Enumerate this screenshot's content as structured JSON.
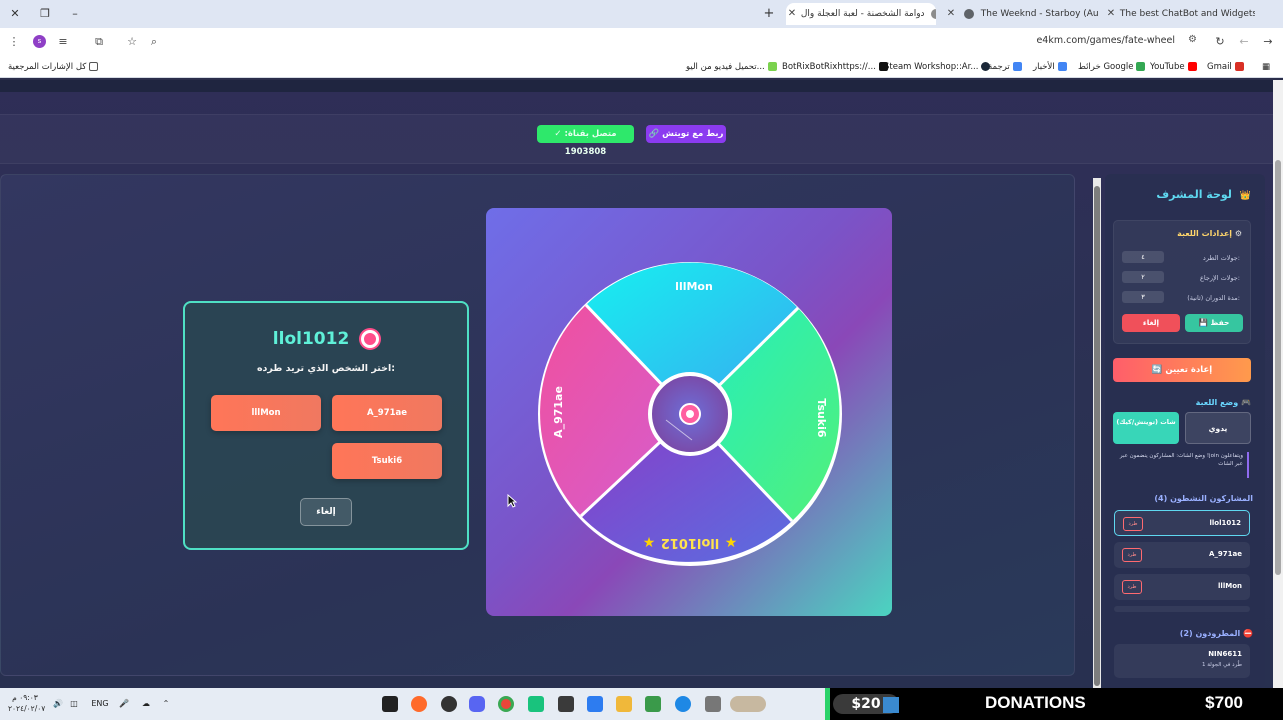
{
  "browser": {
    "tabs": [
      {
        "title": "The best ChatBot and Widgets",
        "favicon_color": "#2b2b2b"
      },
      {
        "title": "The Weeknd - Starboy (Au",
        "favicon_color": "#ff0000"
      },
      {
        "title": "دوامة الشخصنة - لعبة العجلة وال",
        "favicon_color": "#8c8c8c",
        "active": true
      }
    ],
    "new_tab_label": "+",
    "url": "e4km.com/games/fate-wheel",
    "profile_initial": "s",
    "bookmarks": [
      {
        "label": "Gmail",
        "color": "#d93025"
      },
      {
        "label": "YouTube",
        "color": "#ff0000"
      },
      {
        "label": "خرائط Google",
        "color": "#34a853"
      },
      {
        "label": "الأخبار",
        "color": "#4285f4"
      },
      {
        "label": "ترجمة",
        "color": "#4285f4"
      },
      {
        "label": "Steam Workshop::Ar...",
        "color": "#1b2838"
      },
      {
        "label": "BotRixBotRixhttps://...",
        "color": "#111111"
      },
      {
        "label": "تحميل فيديو من اليو...",
        "color": "#7bd24e"
      }
    ],
    "all_bookmarks_label": "كل الإشارات المرجعية"
  },
  "header": {
    "connected_label": "✓ متصل بقناة: 1903808",
    "twitch_button_label": "🔗 ربط مع تويتش"
  },
  "modal": {
    "title": "llol1012",
    "prompt": "اختر الشخص الذي تريد طرده:",
    "options": [
      "A_971ae",
      "lllMon",
      "Tsuki6"
    ],
    "cancel_label": "إلغاء"
  },
  "wheel": {
    "segments": [
      {
        "name": "lllMon",
        "color": "#25e3ee"
      },
      {
        "name": "Tsuki6",
        "color": "#3ef0a8"
      },
      {
        "name": "llol1012",
        "color": "#7a4ad8"
      },
      {
        "name": "A_971ae",
        "color": "#ef5cb4"
      }
    ],
    "highlighted": "llol1012"
  },
  "sidebar": {
    "title": "لوحة المشرف",
    "settings": {
      "heading": "إعدادات اللعبة",
      "rows": [
        {
          "label": "جولات الطرد:",
          "value": "٤"
        },
        {
          "label": "جولات الإرجاع:",
          "value": "٢"
        },
        {
          "label": "مدة الدوران (ثانية):",
          "value": "٣"
        }
      ],
      "save_label": "💾 حفظ",
      "cancel_label": "إلغاء"
    },
    "reset_label": "🔄 إعادة تعيين",
    "mode": {
      "heading": "وضع اللعبة",
      "chat_label": "شات (تويتش/كيك)",
      "manual_label": "يدوي",
      "note": "وضع الشات: المشاركون ينضمون عبر !join ويتفاعلون عبر الشات"
    },
    "active": {
      "heading": "المشاركون النشطون (4)",
      "players": [
        "llol1012",
        "A_971ae",
        "lllMon"
      ],
      "kick_label": "طرد"
    },
    "kicked": {
      "heading": "المطرودون (2)",
      "players": [
        {
          "name": "NIN6611",
          "detail": "طُرد في الجولة 1"
        }
      ]
    }
  },
  "taskbar": {
    "time": "٠٩:٠٣ م",
    "date": "٢٠٢٤/٠٢/٠٧",
    "lang": "ENG"
  },
  "donations": {
    "latest_amount": "$20",
    "label": "DONATIONS",
    "total": "$700"
  }
}
